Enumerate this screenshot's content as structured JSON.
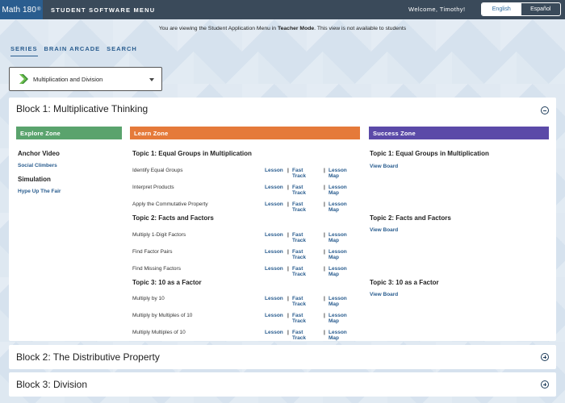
{
  "header": {
    "logo": "Math 180",
    "logo_mark": "®",
    "app_title": "STUDENT SOFTWARE MENU",
    "welcome": "Welcome, Timothy!",
    "lang_active": "English",
    "lang_inactive": "Español"
  },
  "notice": {
    "prefix": "You are viewing the Student Application Menu in",
    "mode": "Teacher Mode",
    "suffix": ". This view is not available to students"
  },
  "tabs": [
    "SERIES",
    "BRAIN ARCADE",
    "SEARCH"
  ],
  "series_select": {
    "value": "Multiplication and Division"
  },
  "colors": {
    "explore": "#5aa36d",
    "learn": "#e57a3a",
    "success": "#5b4aa8",
    "link": "#2a5d8f",
    "topbar": "#3a4a5a"
  },
  "blocks": [
    {
      "title": "Block 1: Multiplicative Thinking",
      "expanded": true,
      "zones": {
        "explore": "Explore Zone",
        "learn": "Learn Zone",
        "success": "Success Zone"
      },
      "explore": {
        "anchor_heading": "Anchor Video",
        "anchor_link": "Social Climbers",
        "sim_heading": "Simulation",
        "sim_link": "Hype Up The Fair"
      },
      "topics": [
        {
          "title": "Topic 1: Equal Groups in Multiplication",
          "success_link": "View Board",
          "items": [
            "Identify Equal Groups",
            "Interpret Products",
            "Apply the Commutative Property"
          ]
        },
        {
          "title": "Topic 2: Facts and Factors",
          "success_link": "View Board",
          "items": [
            "Multiply 1-Digit Factors",
            "Find Factor Pairs",
            "Find Missing Factors"
          ]
        },
        {
          "title": "Topic 3: 10 as a Factor",
          "success_link": "View Board",
          "items": [
            "Multiply by 10",
            "Multiply by Multiples of 10",
            "Multiply Multiples of 10"
          ]
        }
      ],
      "link_labels": {
        "lesson": "Lesson",
        "fast": "Fast",
        "track": "Track",
        "lesson2": "Lesson",
        "map": "Map",
        "sep": "|"
      }
    },
    {
      "title": "Block 2: The Distributive Property",
      "expanded": false
    },
    {
      "title": "Block 3: Division",
      "expanded": false
    }
  ]
}
